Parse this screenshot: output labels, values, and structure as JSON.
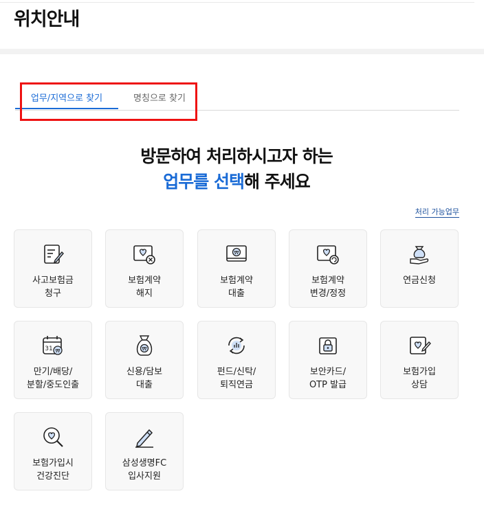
{
  "header": {
    "title": "위치안내"
  },
  "tabs": [
    {
      "label": "업무/지역으로 찾기",
      "active": true
    },
    {
      "label": "명칭으로 찾기",
      "active": false
    }
  ],
  "headline": {
    "line1": "방문하여 처리하시고자 하는",
    "line2_blue": "업무를 선택",
    "line2_rest": "해 주세요"
  },
  "task_link": "처리 가능업무",
  "services": [
    {
      "label": "사고보험금\n청구",
      "icon": "claim-doc-icon"
    },
    {
      "label": "보험계약\n해지",
      "icon": "contract-cancel-icon"
    },
    {
      "label": "보험계약\n대출",
      "icon": "contract-loan-icon"
    },
    {
      "label": "보험계약\n변경/정정",
      "icon": "contract-change-icon"
    },
    {
      "label": "연금신청",
      "icon": "money-bag-hand-icon"
    },
    {
      "label": "만기/배당/\n분할/중도인출",
      "icon": "calendar-coin-icon"
    },
    {
      "label": "신용/담보\n대출",
      "icon": "money-bag-icon"
    },
    {
      "label": "펀드/신탁/\n퇴직연금",
      "icon": "fund-cycle-icon"
    },
    {
      "label": "보안카드/\nOTP 발급",
      "icon": "lock-card-icon"
    },
    {
      "label": "보험가입\n상담",
      "icon": "consult-heart-icon"
    },
    {
      "label": "보험가입시\n건강진단",
      "icon": "health-check-icon"
    },
    {
      "label": "삼성생명FC\n입사지원",
      "icon": "pencil-icon"
    }
  ],
  "colors": {
    "accent": "#1a6bd6",
    "icon_blue": "#cfe0f7",
    "highlight": "#ee1111"
  }
}
